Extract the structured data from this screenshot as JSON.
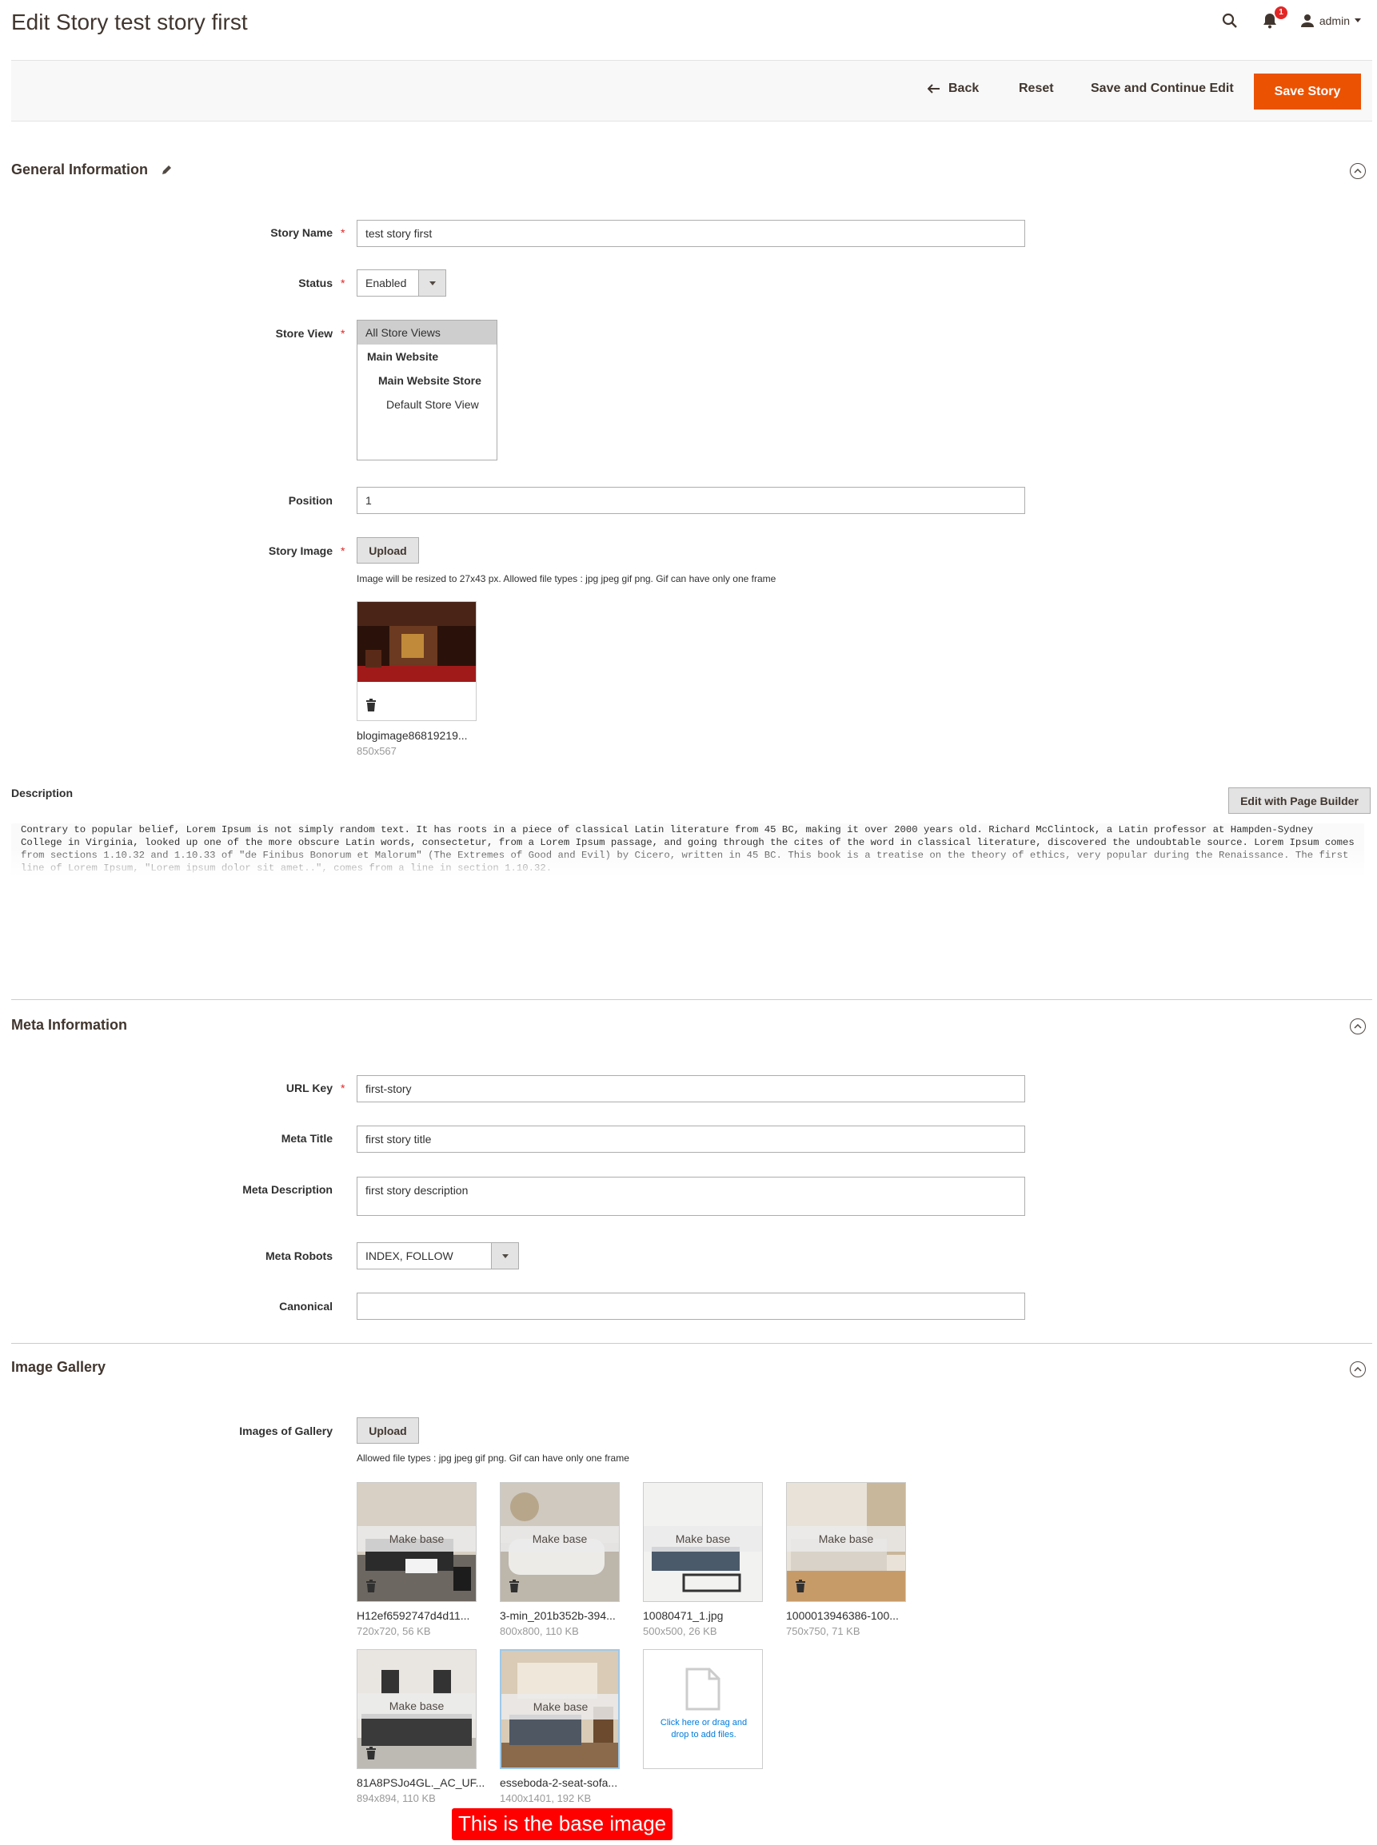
{
  "header": {
    "title": "Edit Story test story first",
    "notification_count": "1",
    "user": "admin"
  },
  "actions": {
    "back": "Back",
    "reset": "Reset",
    "save_continue": "Save and Continue Edit",
    "save": "Save Story"
  },
  "general": {
    "title": "General Information",
    "story_name_label": "Story Name",
    "story_name_value": "test story first",
    "status_label": "Status",
    "status_value": "Enabled",
    "store_view_label": "Store View",
    "store_options": [
      "All Store Views",
      "Main Website",
      "Main Website Store",
      "Default Store View"
    ],
    "position_label": "Position",
    "position_value": "1",
    "story_image_label": "Story Image",
    "upload_label": "Upload",
    "image_note": "Image will be resized to 27x43 px. Allowed file types : jpg jpeg gif png. Gif can have only one frame",
    "image_name": "blogimage86819219...",
    "image_size": "850x567",
    "description_label": "Description",
    "page_builder_label": "Edit with Page Builder",
    "description_text": "Contrary to popular belief, Lorem Ipsum is not simply random text. It has roots in a piece of classical Latin literature from 45 BC, making it over 2000 years old. Richard McClintock, a Latin professor at Hampden-Sydney College in Virginia, looked up one of the more obscure Latin words, consectetur, from a Lorem Ipsum passage, and going through the cites of the word in classical literature, discovered the undoubtable source. Lorem Ipsum comes from sections 1.10.32 and 1.10.33 of \"de Finibus Bonorum et Malorum\" (The Extremes of Good and Evil) by Cicero, written in 45 BC. This book is a treatise on the theory of ethics, very popular during the Renaissance. The first line of Lorem Ipsum, \"Lorem ipsum dolor sit amet..\", comes from a line in section 1.10.32."
  },
  "meta": {
    "title": "Meta Information",
    "url_key_label": "URL Key",
    "url_key_value": "first-story",
    "meta_title_label": "Meta Title",
    "meta_title_value": "first story title",
    "meta_desc_label": "Meta Description",
    "meta_desc_value": "first story description",
    "robots_label": "Meta Robots",
    "robots_value": "INDEX, FOLLOW",
    "canonical_label": "Canonical",
    "canonical_value": ""
  },
  "gallery": {
    "title": "Image Gallery",
    "images_label": "Images of Gallery",
    "upload_label": "Upload",
    "note": "Allowed file types : jpg jpeg gif png. Gif can have only one frame",
    "make_base_label": "Make base",
    "items": [
      {
        "name": "H12ef6592747d4d11...",
        "meta": "720x720, 56 KB"
      },
      {
        "name": "3-min_201b352b-394...",
        "meta": "800x800, 110 KB"
      },
      {
        "name": "10080471_1.jpg",
        "meta": "500x500, 26 KB"
      },
      {
        "name": "1000013946386-100...",
        "meta": "750x750, 71 KB"
      },
      {
        "name": "81A8PSJo4GL._AC_UF...",
        "meta": "894x894, 110 KB"
      },
      {
        "name": "esseboda-2-seat-sofa...",
        "meta": "1400x1401, 192 KB"
      }
    ],
    "drop_text": "Click here or drag and drop to add files.",
    "base_banner": "This is the base image"
  },
  "colors": {
    "accent": "#eb5202",
    "banner": "#ff0000",
    "link": "#007bdb"
  }
}
